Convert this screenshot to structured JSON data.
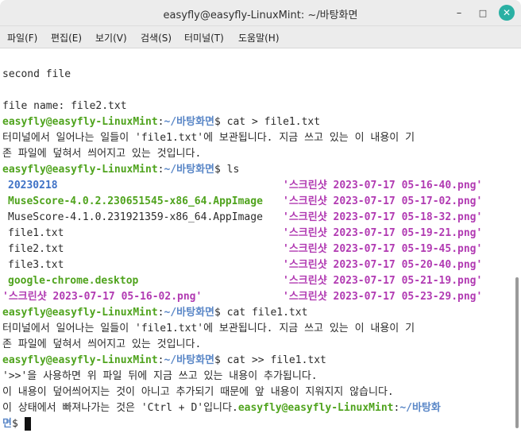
{
  "window": {
    "title": "easyfly@easyfly-LinuxMint: ~/바탕화면",
    "minimize_icon": "–",
    "maximize_icon": "□",
    "close_icon": "✕"
  },
  "menu": [
    "파일(F)",
    "편집(E)",
    "보기(V)",
    "검색(S)",
    "터미널(T)",
    "도움말(H)"
  ],
  "terminal": {
    "prompt_user": "easyfly@easyfly-LinuxMint",
    "prompt_path": "~/바탕화면",
    "prompt_path_part1": "~/바탕화",
    "prompt_path_part2": "면",
    "prompt_sep": ":",
    "prompt_suffix": "$ ",
    "line_second_file": "second file",
    "line_file_name": "file name: file2.txt",
    "cmd1": "cat > file1.txt",
    "out1_a": "터미널에서 일어나는 일들이 'file1.txt'에 보관됩니다. 지금 쓰고 있는 이 내용이 기",
    "out1_b": "존 파일에 덮혀서 씌어지고 있는 것입니다.",
    "cmd2": "ls",
    "ls": {
      "l1_left": "20230218",
      "l1_right": "'스크린샷 2023-07-17 05-16-40.png'",
      "l2_left": "MuseScore-4.0.2.230651545-x86_64.AppImage",
      "l2_right": "'스크린샷 2023-07-17 05-17-02.png'",
      "l3_left": "MuseScore-4.1.0.231921359-x86_64.AppImage",
      "l3_right": "'스크린샷 2023-07-17 05-18-32.png'",
      "l4_left": "file1.txt",
      "l4_right": "'스크린샷 2023-07-17 05-19-21.png'",
      "l5_left": "file2.txt",
      "l5_right": "'스크린샷 2023-07-17 05-19-45.png'",
      "l6_left": "file3.txt",
      "l6_right": "'스크린샷 2023-07-17 05-20-40.png'",
      "l7_left": "google-chrome.desktop",
      "l7_right": "'스크린샷 2023-07-17 05-21-19.png'",
      "l8_left": "'스크린샷 2023-07-17 05-16-02.png'",
      "l8_right": "'스크린샷 2023-07-17 05-23-29.png'"
    },
    "cmd3": "cat file1.txt",
    "out3_a": "터미널에서 일어나는 일들이 'file1.txt'에 보관됩니다. 지금 쓰고 있는 이 내용이 기",
    "out3_b": "존 파일에 덮혀서 씌어지고 있는 것입니다.",
    "cmd4": "cat >> file1.txt",
    "out4_a": "'>>'을 사용하면 위 파일 뒤에 지금 쓰고 있는 내용이 추가됩니다.",
    "out4_b": "이 내용이 덮어씌어지는 것이 아니고 추가되기 때문에 앞 내용이 지워지지 않습니다.",
    "out4_c": "이 상태에서 빠져나가는 것은 'Ctrl + D'입니다."
  },
  "colors": {
    "user": "#4fa31d",
    "path": "#5a87c7",
    "png": "#b13ab2",
    "close_button": "#2ab0a3"
  }
}
